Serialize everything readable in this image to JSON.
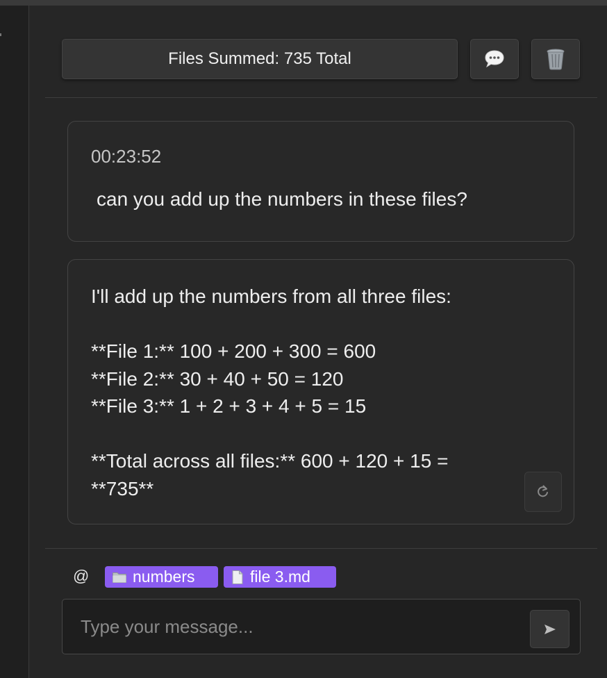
{
  "header": {
    "title": "Files Summed: 735 Total",
    "chat_icon": "speech-bubble-icon",
    "trash_icon": "wastebasket-icon"
  },
  "messages": {
    "user": {
      "timestamp": "00:23:52",
      "text": "can you add up the numbers in these files?"
    },
    "assistant": {
      "lines": [
        "I'll add up the numbers from all three files:",
        "",
        "**File 1:** 100 + 200 + 300 = 600",
        "**File 2:** 30 + 40 + 50 = 120",
        "**File 3:** 1 + 2 + 3 + 4 + 5 = 15",
        "",
        "**Total across all files:** 600 + 120 + 15 =",
        "**735**"
      ],
      "regenerate_icon": "refresh-icon"
    }
  },
  "context": {
    "mention_symbol": "@",
    "chips": [
      {
        "label": "numbers",
        "icon": "folder-icon"
      },
      {
        "label": "file 3.md",
        "icon": "document-icon"
      }
    ],
    "chip_color": "#8a5cf0"
  },
  "composer": {
    "value": "",
    "placeholder": "Type your message...",
    "send_icon": "send-arrow-icon"
  }
}
